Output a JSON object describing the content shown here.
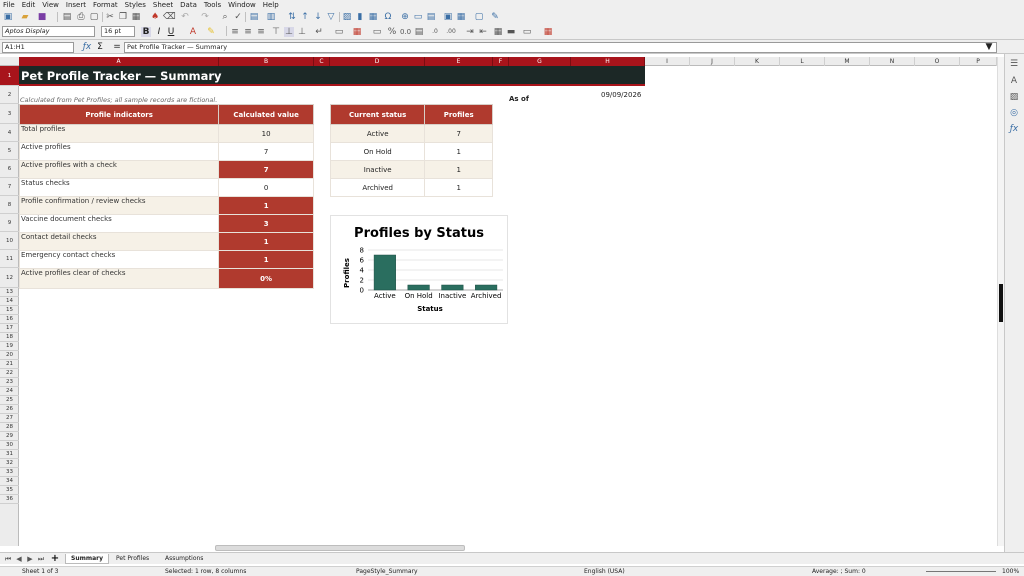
{
  "menu": [
    "File",
    "Edit",
    "View",
    "Insert",
    "Format",
    "Styles",
    "Sheet",
    "Data",
    "Tools",
    "Window",
    "Help"
  ],
  "toolbar": {
    "font_name": "Aptos Display",
    "font_size": "16 pt",
    "bold": "B",
    "italic": "I",
    "underline": "U"
  },
  "formula_bar": {
    "name_box": "A1:H1",
    "sum_symbol": "Σ",
    "equals_symbol": "=",
    "content": "Pet Profile Tracker — Summary"
  },
  "columns": [
    "A",
    "B",
    "C",
    "D",
    "E",
    "F",
    "G",
    "H",
    "I",
    "J",
    "K",
    "L",
    "M",
    "N",
    "O",
    "P"
  ],
  "rows": [
    "1",
    "2",
    "3",
    "4",
    "5",
    "6",
    "7",
    "8",
    "9",
    "10",
    "11",
    "12",
    "13",
    "14",
    "15",
    "16",
    "17",
    "18",
    "19",
    "20",
    "21",
    "22",
    "23",
    "24",
    "25",
    "26",
    "27",
    "28",
    "29",
    "30",
    "31",
    "32",
    "33",
    "34",
    "35",
    "36"
  ],
  "sheet": {
    "title": "Pet Profile Tracker — Summary",
    "note": "Calculated from Pet Profiles; all sample records are fictional.",
    "as_of_label": "As of",
    "as_of_date": "09/09/2026",
    "indicators": {
      "header_label": "Profile indicators",
      "header_value": "Calculated value",
      "rows": [
        {
          "label": "Total profiles",
          "value": "10"
        },
        {
          "label": "Active profiles",
          "value": "7"
        },
        {
          "label": "Active profiles with a check",
          "value": "7"
        },
        {
          "label": "Status checks",
          "value": "0"
        },
        {
          "label": "Profile confirmation / review checks",
          "value": "1"
        },
        {
          "label": "Vaccine document checks",
          "value": "3"
        },
        {
          "label": "Contact detail checks",
          "value": "1"
        },
        {
          "label": "Emergency contact checks",
          "value": "1"
        },
        {
          "label": "Active profiles clear of checks",
          "value": "0%"
        }
      ]
    },
    "status_table": {
      "header_status": "Current status",
      "header_profiles": "Profiles",
      "rows": [
        {
          "status": "Active",
          "profiles": "7"
        },
        {
          "status": "On Hold",
          "profiles": "1"
        },
        {
          "status": "Inactive",
          "profiles": "1"
        },
        {
          "status": "Archived",
          "profiles": "1"
        }
      ]
    }
  },
  "chart_data": {
    "type": "bar",
    "title": "Profiles by Status",
    "xlabel": "Status",
    "ylabel": "Profiles",
    "categories": [
      "Active",
      "On Hold",
      "Inactive",
      "Archived"
    ],
    "values": [
      7,
      1,
      1,
      1
    ],
    "yticks": [
      "0",
      "2",
      "4",
      "6",
      "8"
    ],
    "ylim": [
      0,
      8
    ],
    "grid": true,
    "bar_color": "#2a6e5f"
  },
  "sheet_tabs": [
    "Summary",
    "Pet Profiles",
    "Assumptions"
  ],
  "status_bar": {
    "sheet_pos": "Sheet 1 of 3",
    "selection": "Selected: 1 row, 8 columns",
    "page_style": "PageStyle_Summary",
    "language": "English (USA)",
    "calc": "Average: ; Sum: 0",
    "zoom": "100%"
  },
  "colors": {
    "accent_red": "#b03a2e",
    "title_dark": "#1c2826",
    "row_alt": "#f6f1e7"
  }
}
